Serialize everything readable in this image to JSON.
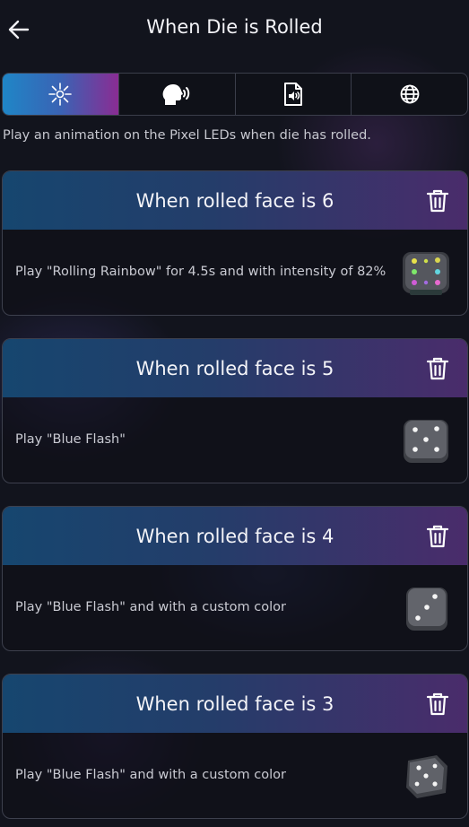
{
  "header": {
    "title": "When Die is Rolled"
  },
  "tabs": [
    {
      "name": "led-animation",
      "icon": "sparkle-icon",
      "active": true
    },
    {
      "name": "speak",
      "icon": "speaking-head-icon",
      "active": false
    },
    {
      "name": "audio",
      "icon": "audio-file-icon",
      "active": false
    },
    {
      "name": "web",
      "icon": "globe-icon",
      "active": false
    }
  ],
  "subtitle": "Play an animation on the Pixel LEDs when die has rolled.",
  "rules": [
    {
      "title": "When rolled face is 6",
      "description": "Play \"Rolling Rainbow\" for 4.5s and with intensity of 82%"
    },
    {
      "title": "When rolled face is 5",
      "description": "Play \"Blue Flash\""
    },
    {
      "title": "When rolled face is 4",
      "description": "Play \"Blue Flash\" and with a custom color"
    },
    {
      "title": "When rolled face is 3",
      "description": "Play \"Blue Flash\" and with a custom color"
    }
  ],
  "colors": {
    "accent_blue": "#1f86c7",
    "accent_purple": "#8a2c93",
    "background": "#12141d"
  }
}
